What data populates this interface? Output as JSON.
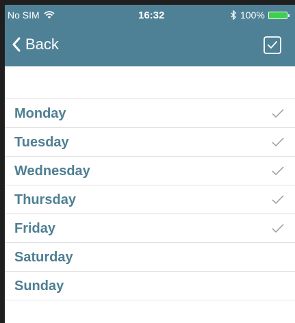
{
  "status_bar": {
    "carrier": "No SIM",
    "time": "16:32",
    "battery_percent": "100%",
    "wifi_icon": "wifi-icon",
    "bluetooth_icon": "bluetooth-icon",
    "battery_icon": "battery-icon"
  },
  "nav": {
    "back_label": "Back",
    "back_icon": "chevron-left-icon",
    "confirm_icon": "checkbox-checked-icon"
  },
  "days": [
    {
      "label": "Monday",
      "checked": true
    },
    {
      "label": "Tuesday",
      "checked": true
    },
    {
      "label": "Wednesday",
      "checked": true
    },
    {
      "label": "Thursday",
      "checked": true
    },
    {
      "label": "Friday",
      "checked": true
    },
    {
      "label": "Saturday",
      "checked": false
    },
    {
      "label": "Sunday",
      "checked": false
    }
  ],
  "colors": {
    "header_background": "#4f8196",
    "day_label": "#4e7f93",
    "checkmark": "#9a9a9a",
    "battery_fill": "#3cd04c"
  }
}
